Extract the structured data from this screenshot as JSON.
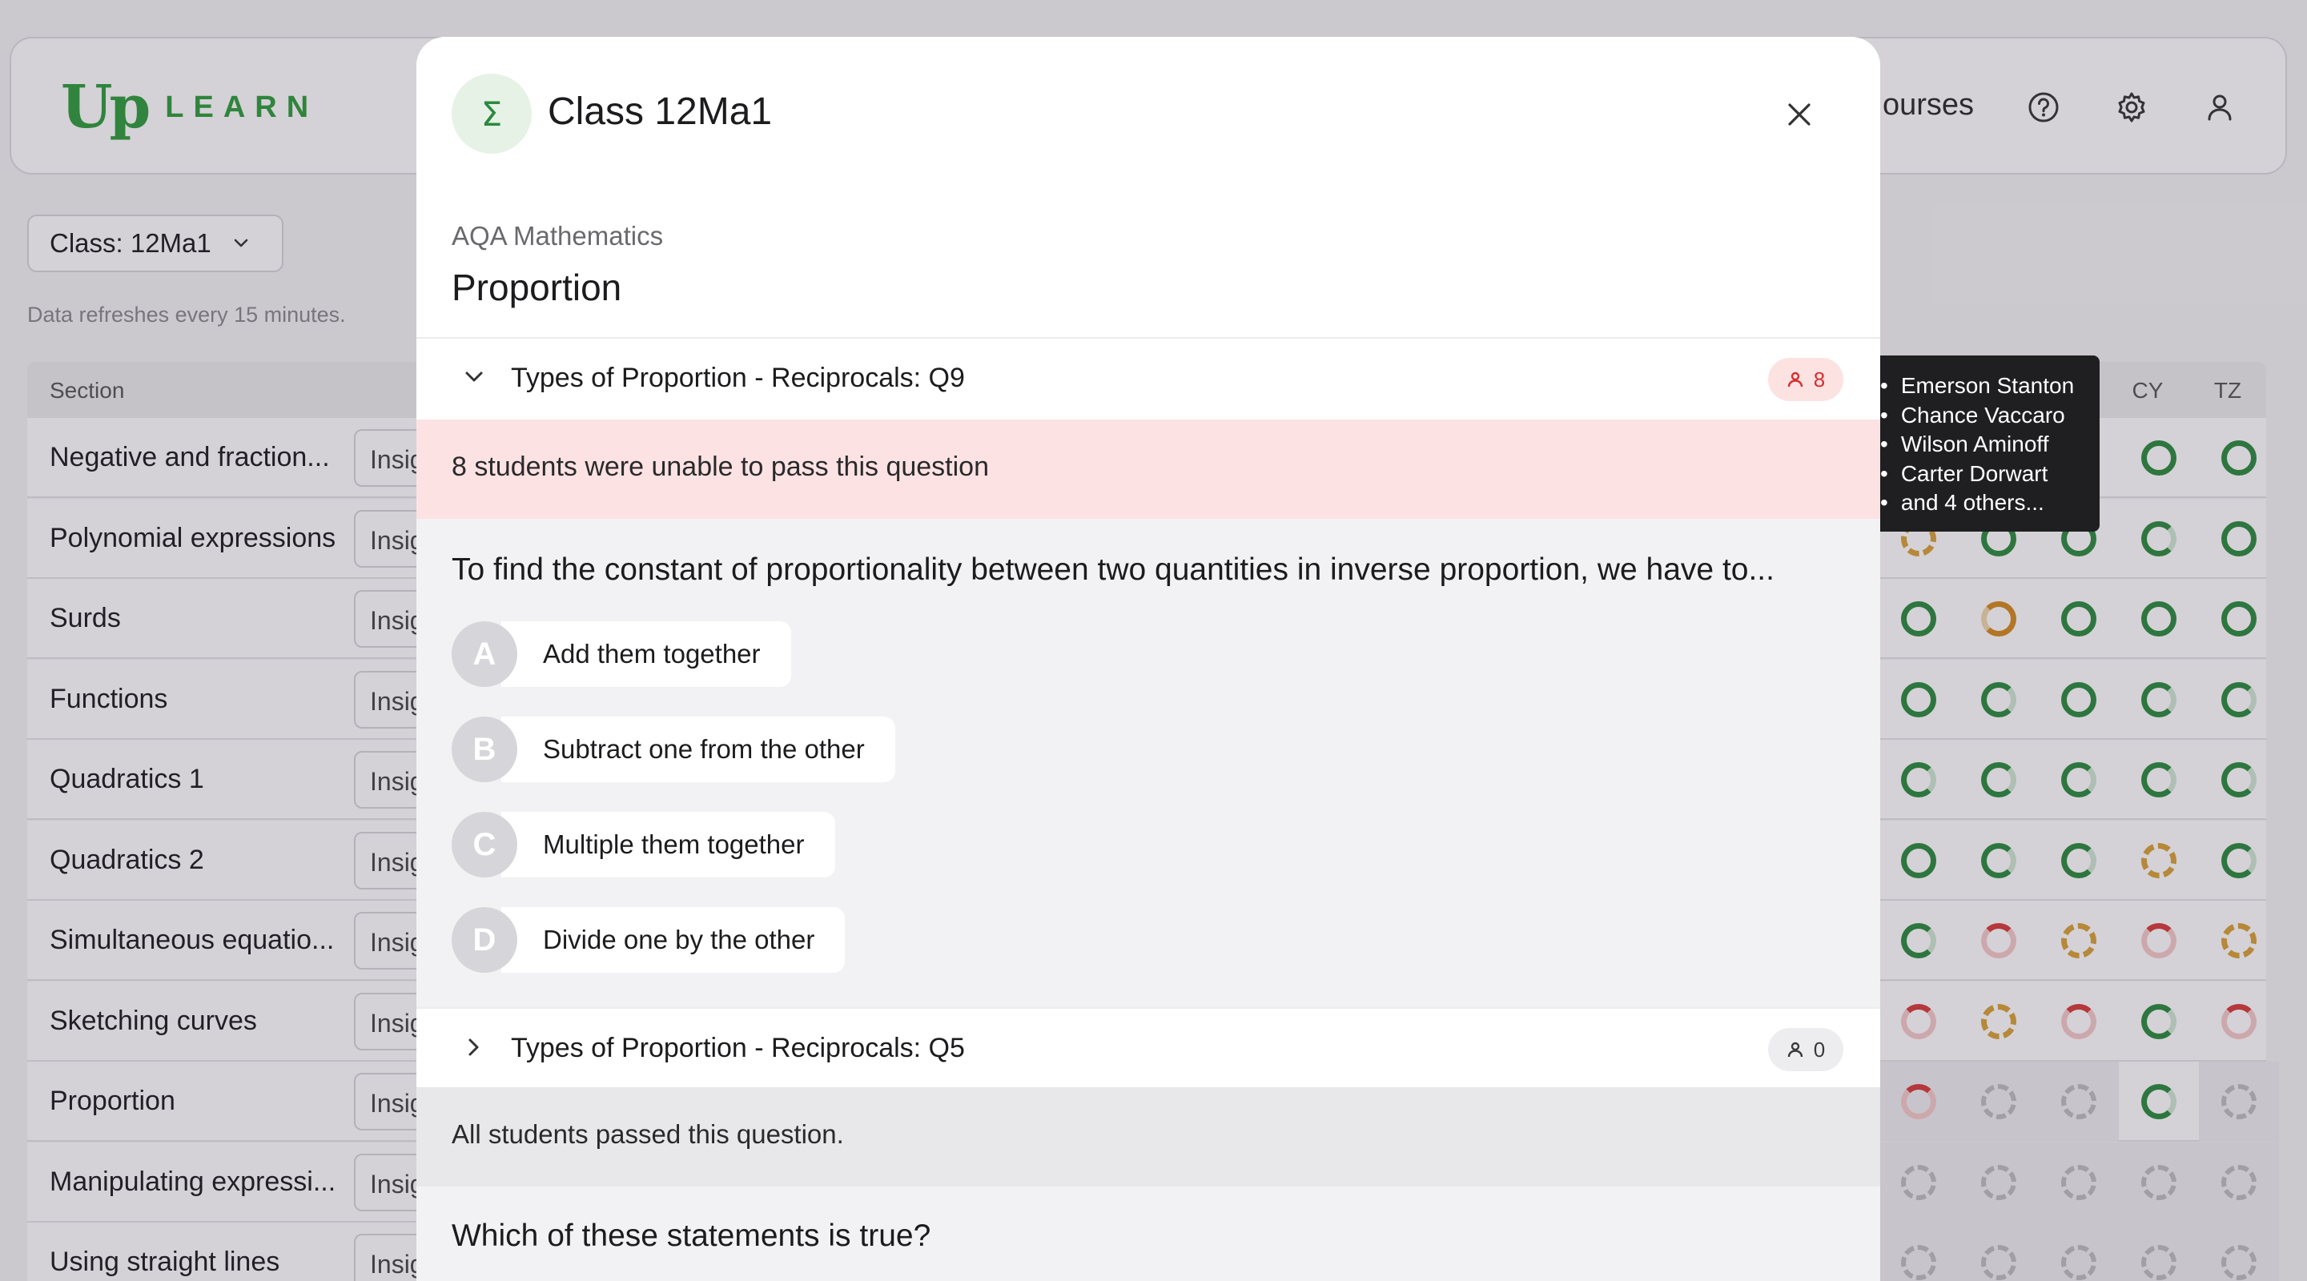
{
  "app": {
    "logo_up": "Up",
    "logo_learn": "LEARN",
    "nav_courses": "ourses",
    "class_select": "Class: 12Ma1",
    "refresh_note": "Data refreshes every 15 minutes.",
    "table": {
      "section_header": "Section",
      "insights_label": "Insights",
      "columns": [
        "CY",
        "TZ"
      ],
      "rows": [
        {
          "label": "Negative and fraction...",
          "cells": [
            "g",
            "g",
            "g",
            "g",
            "g"
          ]
        },
        {
          "label": "Polynomial expressions",
          "cells": [
            "od",
            "g",
            "g",
            "gp",
            "g"
          ]
        },
        {
          "label": "Surds",
          "cells": [
            "g",
            "o",
            "g",
            "g",
            "g"
          ]
        },
        {
          "label": "Functions",
          "cells": [
            "g",
            "gp",
            "g",
            "gp",
            "gp"
          ]
        },
        {
          "label": "Quadratics 1",
          "cells": [
            "gp",
            "gp",
            "gp",
            "gp",
            "gp"
          ]
        },
        {
          "label": "Quadratics 2",
          "cells": [
            "g",
            "gp",
            "gp",
            "od",
            "gp"
          ]
        },
        {
          "label": "Simultaneous equatio...",
          "cells": [
            "gp",
            "r",
            "od",
            "r",
            "od"
          ]
        },
        {
          "label": "Sketching curves",
          "cells": [
            "r",
            "od",
            "r",
            "gp",
            "r"
          ]
        },
        {
          "label": "Proportion",
          "cells": [
            "r",
            "x",
            "x",
            "gp",
            "x"
          ]
        },
        {
          "label": "Manipulating expressi...",
          "cells": [
            "x",
            "x",
            "x",
            "x",
            "x"
          ]
        },
        {
          "label": "Using straight lines",
          "cells": [
            "x",
            "x",
            "x",
            "x",
            "x"
          ]
        }
      ]
    }
  },
  "tooltip": {
    "items": [
      "Emerson Stanton",
      "Chance Vaccaro",
      "Wilson Aminoff",
      "Carter Dorwart",
      "and 4 others..."
    ]
  },
  "modal": {
    "class_title": "Class 12Ma1",
    "course_subtitle": "AQA Mathematics",
    "course_title": "Proportion",
    "question1": {
      "title": "Types of Proportion - Reciprocals: Q9",
      "badge_count": "8",
      "banner": "8 students were unable to pass this question",
      "text": "To find the constant of proportionality between two quantities in inverse proportion, we have to...",
      "options": [
        {
          "letter": "A",
          "text": "Add them together"
        },
        {
          "letter": "B",
          "text": "Subtract one from the other"
        },
        {
          "letter": "C",
          "text": "Multiple them together"
        },
        {
          "letter": "D",
          "text": "Divide one by the other"
        }
      ]
    },
    "question2": {
      "title": "Types of Proportion - Reciprocals: Q5",
      "badge_count": "0",
      "banner": "All students passed this question.",
      "text": "Which of these statements is true?"
    }
  },
  "colors": {
    "brand_green": "#2e9c3c",
    "fail_red": "#d62f2f",
    "fail_banner": "#fde2e4"
  }
}
